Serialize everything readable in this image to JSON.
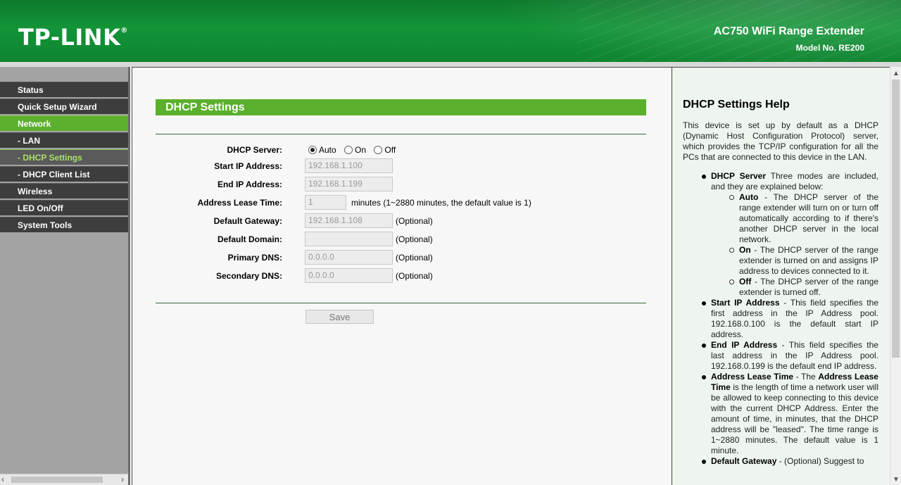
{
  "header": {
    "brand": "TP-LINK",
    "brand_mark": "®",
    "product": "AC750 WiFi Range Extender",
    "model": "Model No. RE200"
  },
  "sidebar": {
    "items": [
      {
        "label": "Status"
      },
      {
        "label": "Quick Setup Wizard"
      },
      {
        "label": "Network"
      },
      {
        "label": "- LAN"
      },
      {
        "label": "- DHCP Settings"
      },
      {
        "label": "- DHCP Client List"
      },
      {
        "label": "Wireless"
      },
      {
        "label": "LED On/Off"
      },
      {
        "label": "System Tools"
      }
    ]
  },
  "main": {
    "title": "DHCP Settings",
    "dhcp_server": {
      "label": "DHCP Server:",
      "options": [
        "Auto",
        "On",
        "Off"
      ],
      "selected": "Auto"
    },
    "start_ip": {
      "label": "Start IP Address:",
      "value": "192.168.1.100"
    },
    "end_ip": {
      "label": "End IP Address:",
      "value": "192.168.1.199"
    },
    "lease_time": {
      "label": "Address Lease Time:",
      "value": "1",
      "hint": "minutes (1~2880 minutes, the default value is 1)"
    },
    "gateway": {
      "label": "Default Gateway:",
      "value": "192.168.1.108",
      "hint": "(Optional)"
    },
    "domain": {
      "label": "Default Domain:",
      "value": "",
      "hint": "(Optional)"
    },
    "primary_dns": {
      "label": "Primary DNS:",
      "value": "0.0.0.0",
      "hint": "(Optional)"
    },
    "secondary_dns": {
      "label": "Secondary DNS:",
      "value": "0.0.0.0",
      "hint": "(Optional)"
    },
    "save_label": "Save"
  },
  "help": {
    "title": "DHCP Settings Help",
    "intro": "This device is set up by default as a DHCP (Dynamic Host Configuration Protocol) server, which provides the TCP/IP configuration for all the PCs that are connected to this device in the LAN.",
    "items": {
      "dhcp_server": {
        "term": "DHCP Server",
        "text": " Three modes are included, and they are explained below:"
      },
      "auto": {
        "term": "Auto",
        "text": " - The DHCP server of the range extender will turn on or turn off automatically according to if there's another DHCP server in the local network."
      },
      "on": {
        "term": "On",
        "text": " - The DHCP server of the range extender is turned on and assigns IP address to devices connected to it."
      },
      "off": {
        "term": "Off",
        "text": " - The DHCP server of the range extender is turned off."
      },
      "start_ip": {
        "term": "Start IP Address",
        "text": " - This field specifies the first address in the IP Address pool. 192.168.0.100 is the default start IP address."
      },
      "end_ip": {
        "term": "End IP Address",
        "text": " - This field specifies the last address in the IP Address pool. 192.168.0.199 is the default end IP address."
      },
      "lease": {
        "term": "Address Lease Time",
        "text_a": " - The ",
        "term2": "Address Lease Time",
        "text_b": " is the length of time a network user will be allowed to keep connecting to this device with the current DHCP Address. Enter the amount of time, in minutes, that the DHCP address will be \"leased\". The time range is 1~2880 minutes. The default value is 1 minute."
      },
      "gateway": {
        "term": "Default Gateway",
        "text": " - (Optional) Suggest to"
      }
    }
  }
}
